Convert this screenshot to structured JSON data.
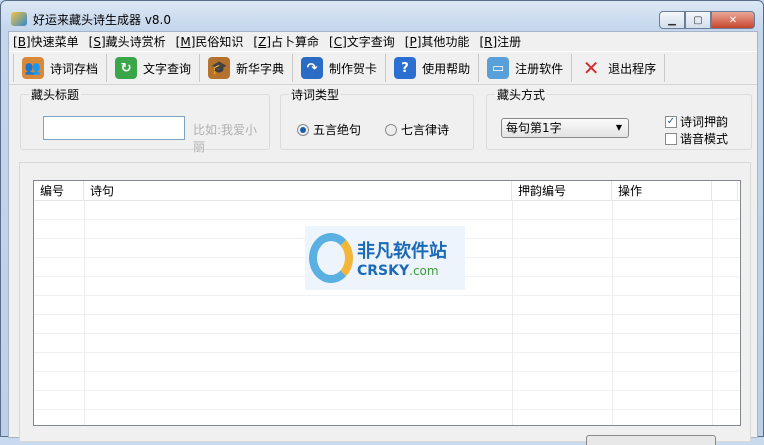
{
  "window": {
    "title": "好运来藏头诗生成器 v8.0"
  },
  "menu": [
    {
      "key": "B",
      "label": "快速菜单"
    },
    {
      "key": "S",
      "label": "藏头诗赏析"
    },
    {
      "key": "M",
      "label": "民俗知识"
    },
    {
      "key": "Z",
      "label": "占卜算命"
    },
    {
      "key": "C",
      "label": "文字查询"
    },
    {
      "key": "P",
      "label": "其他功能"
    },
    {
      "key": "R",
      "label": "注册"
    }
  ],
  "toolbar": [
    {
      "label": "诗词存档",
      "icon": "users-icon",
      "color": "#d9893a"
    },
    {
      "label": "文字查询",
      "icon": "refresh-document-icon",
      "color": "#3aa64a"
    },
    {
      "label": "新华字典",
      "icon": "graduate-icon",
      "color": "#b5722f"
    },
    {
      "label": "制作贺卡",
      "icon": "redo-arrow-icon",
      "color": "#2a6bc4"
    },
    {
      "label": "使用帮助",
      "icon": "help-icon",
      "color": "#2b6fd1"
    },
    {
      "label": "注册软件",
      "icon": "monitor-icon",
      "color": "#5aa0d8"
    },
    {
      "label": "退出程序",
      "icon": "close-x-icon",
      "color": "#d03030"
    }
  ],
  "title_group": {
    "label": "藏头标题",
    "value": "",
    "hint": "比如:我爱小丽"
  },
  "type_group": {
    "label": "诗词类型",
    "options": [
      "五言绝句",
      "七言律诗"
    ],
    "selected": 0
  },
  "mode_group": {
    "label": "藏头方式",
    "select_value": "每句第1字",
    "checks": [
      {
        "label": "诗词押韵",
        "checked": true
      },
      {
        "label": "谐音模式",
        "checked": false
      }
    ]
  },
  "grid": {
    "columns": [
      "编号",
      "诗句",
      "押韵编号",
      "操作",
      ""
    ]
  },
  "watermark": {
    "cn": "非凡软件站",
    "en": "CRSKY",
    "suffix": ".com"
  }
}
